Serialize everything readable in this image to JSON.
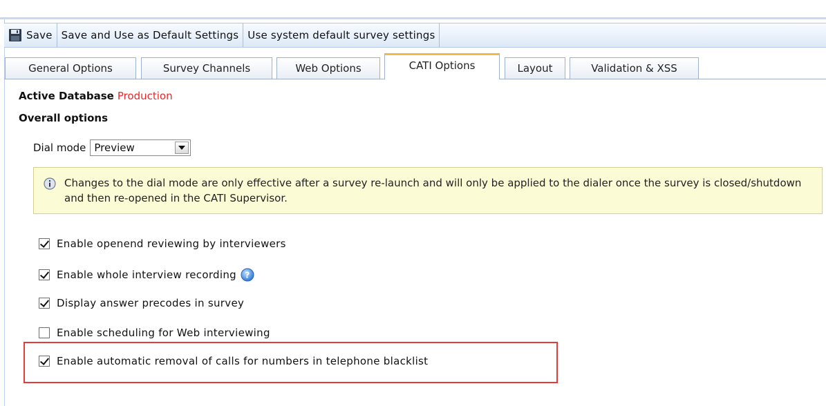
{
  "toolbar": {
    "save_label": "Save",
    "save_default_label": "Save and Use as Default Settings",
    "system_default_label": "Use system default survey settings",
    "save_icon": "save-icon"
  },
  "tabs": [
    {
      "label": "General Options",
      "active": false
    },
    {
      "label": "Survey Channels",
      "active": false
    },
    {
      "label": "Web Options",
      "active": false
    },
    {
      "label": "CATI Options",
      "active": true
    },
    {
      "label": "Layout",
      "active": false
    },
    {
      "label": "Validation & XSS",
      "active": false
    }
  ],
  "active_database": {
    "label": "Active Database",
    "value": "Production",
    "value_color": "#e8282a"
  },
  "overall_options": {
    "title": "Overall options"
  },
  "dial_mode": {
    "label": "Dial mode",
    "selected": "Preview"
  },
  "info_message": {
    "icon": "info-icon",
    "text": "Changes to the dial mode are only effective after a survey re-launch and will only be applied to the dialer once the survey is closed/shutdown and then re-opened in the CATI Supervisor."
  },
  "options": [
    {
      "label": "Enable openend reviewing by interviewers",
      "checked": true
    },
    {
      "label": "Enable whole interview recording",
      "checked": true,
      "help_icon": "help-icon"
    },
    {
      "label": "Display answer precodes in survey",
      "checked": true
    },
    {
      "label": "Enable scheduling for Web interviewing",
      "checked": false
    },
    {
      "label": "Enable automatic removal of calls for numbers in telephone blacklist",
      "checked": true,
      "highlighted": true
    }
  ],
  "colors": {
    "accent_tab": "#f2b84b",
    "highlight_border": "#e33a3a",
    "info_bg": "#fbfbd6"
  }
}
